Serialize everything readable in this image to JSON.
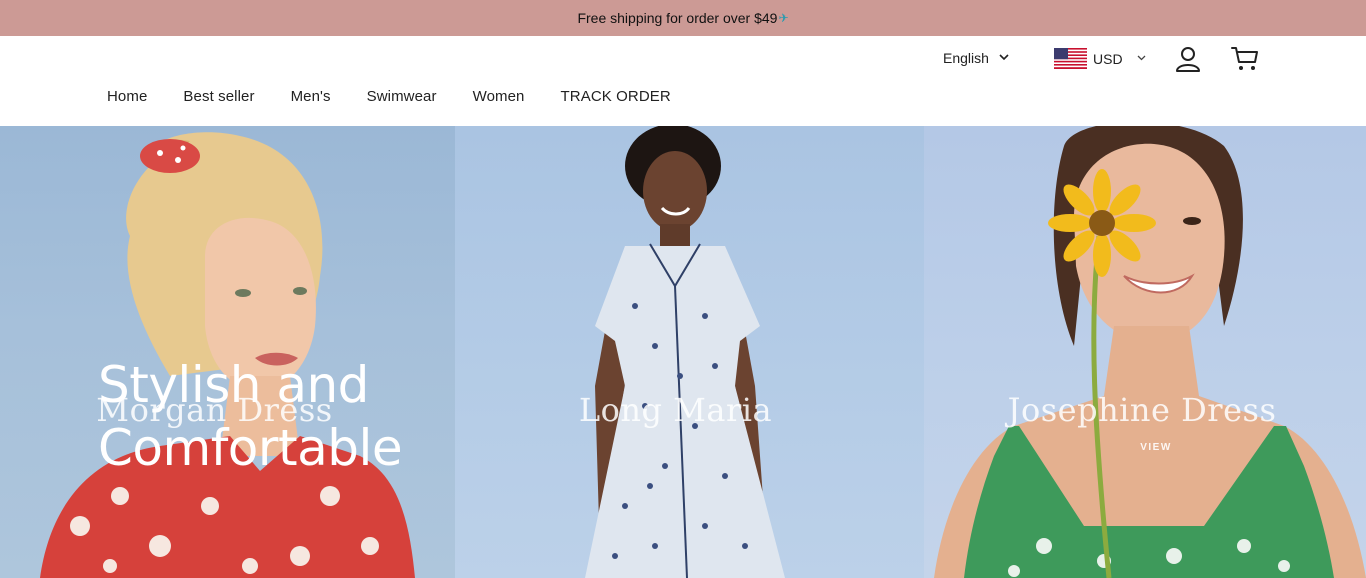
{
  "announcement": {
    "text": "Free shipping for order over $49",
    "icon": "airplane-icon"
  },
  "header": {
    "language": {
      "selected": "English"
    },
    "currency": {
      "selected": "USD",
      "flag": "us-flag-icon"
    },
    "icons": {
      "account": "user-icon",
      "cart": "cart-icon"
    },
    "nav": [
      "Home",
      "Best seller",
      "Men's",
      "Swimwear",
      "Women",
      "TRACK ORDER"
    ]
  },
  "hero": {
    "heading_line1": "Stylish and",
    "heading_line2": "Comfortable",
    "panels": [
      {
        "title": "Morgan Dress",
        "view": ""
      },
      {
        "title": "Long Maria",
        "view": ""
      },
      {
        "title": "Josephine Dress",
        "view": "VIEW"
      }
    ]
  },
  "colors": {
    "announcement_bg": "#cc9a95",
    "text": "#222222",
    "hero_blue": "#a6c0da"
  }
}
